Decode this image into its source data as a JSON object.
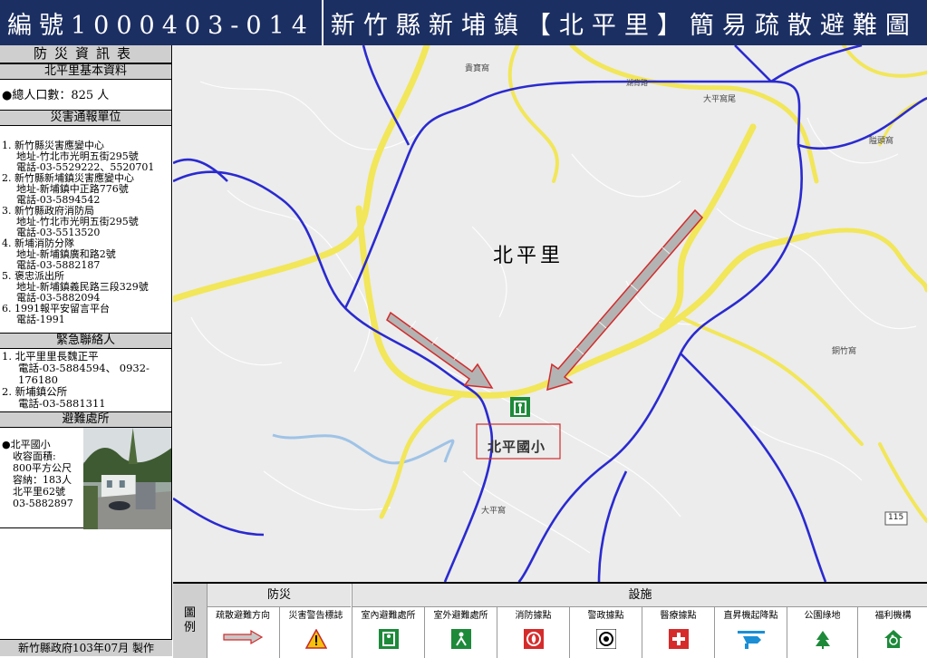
{
  "header": {
    "code": "編號1000403-014",
    "title": "新竹縣新埔鎮【北平里】簡易疏散避難圖"
  },
  "sidebar": {
    "title": "防災資訊表",
    "basic_heading": "北平里基本資料",
    "population": "●總人口數：825 人",
    "units_heading": "災害通報單位",
    "units": [
      {
        "name": "1. 新竹縣災害應變中心",
        "address": "地址-竹北市光明五街295號",
        "phone": "電話-03-5529222、5520701"
      },
      {
        "name": "2. 新竹縣新埔鎮災害應變中心",
        "address": "地址-新埔鎮中正路776號",
        "phone": "電話-03-5894542"
      },
      {
        "name": "3. 新竹縣政府消防局",
        "address": "地址-竹北市光明五街295號",
        "phone": "電話-03-5513520"
      },
      {
        "name": "4. 新埔消防分隊",
        "address": "地址-新埔鎮廣和路2號",
        "phone": "電話-03-5882187"
      },
      {
        "name": "5. 褒忠派出所",
        "address": "地址-新埔鎮義民路三段329號",
        "phone": "電話-03-5882094"
      },
      {
        "name": "6. 1991報平安留言平台",
        "address": "",
        "phone": "電話-1991"
      }
    ],
    "contact_heading": "緊急聯絡人",
    "contacts": [
      {
        "name": "1. 北平里里長魏正平",
        "phone": "電話-03-5884594、 0932-176180"
      },
      {
        "name": "2.  新埔鎮公所",
        "phone": "電話-03-5881311"
      }
    ],
    "shelter_heading": "避難處所",
    "shelter": {
      "name": "●北平國小",
      "lines": [
        "收容面積:",
        "800平方公尺",
        "容納：183人",
        "北平里62號",
        "03-5882897"
      ]
    },
    "footer": "新竹縣政府103年07月 製作"
  },
  "map": {
    "area_label": "北平里",
    "school_label": "北平國小",
    "place_labels": [
      "貴寶窩",
      "大平窩尾",
      "隘頭窩",
      "銅竹窩",
      "大平窩",
      "湖背路"
    ],
    "road_shield": "115",
    "colors": {
      "village_border": "#2a2ad0",
      "road": "#f2e65a",
      "arrow": "#d22b2b",
      "shelter_icon": "#1d8a3a"
    }
  },
  "legend": {
    "side_label_1": "圖",
    "side_label_2": "例",
    "group_disaster": "防災",
    "group_facilities": "設施",
    "items": [
      {
        "label": "疏散避難方向",
        "icon": "evacuation-arrow-icon"
      },
      {
        "label": "災害警告標誌",
        "icon": "warning-sign-icon"
      },
      {
        "label": "室內避難處所",
        "icon": "indoor-shelter-icon"
      },
      {
        "label": "室外避難處所",
        "icon": "outdoor-shelter-icon"
      },
      {
        "label": "消防據點",
        "icon": "fire-station-icon"
      },
      {
        "label": "警政據點",
        "icon": "police-station-icon"
      },
      {
        "label": "醫療據點",
        "icon": "medical-icon"
      },
      {
        "label": "直昇機起降點",
        "icon": "helipad-icon"
      },
      {
        "label": "公園綠地",
        "icon": "park-icon"
      },
      {
        "label": "福利機構",
        "icon": "welfare-icon"
      }
    ]
  }
}
